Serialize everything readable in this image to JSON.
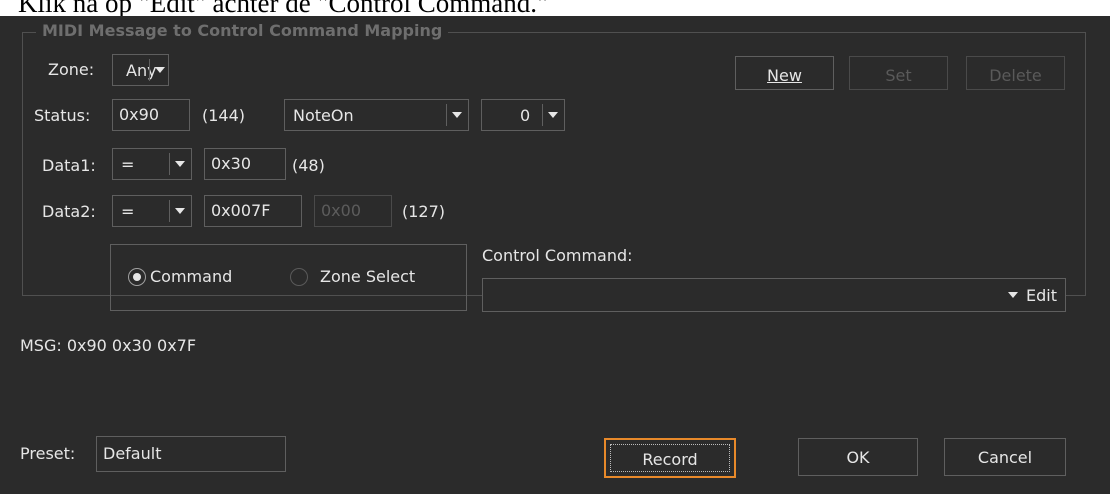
{
  "caption": "Klik na op \"Edit\" achter de \"Control Command.\"",
  "group_title": "MIDI Message to Control Command Mapping",
  "zone": {
    "label": "Zone:",
    "value": "Any"
  },
  "status": {
    "label": "Status:",
    "hex": "0x90",
    "dec": "(144)",
    "type": "NoteOn",
    "channel": "0"
  },
  "data1": {
    "label": "Data1:",
    "op": "=",
    "hex": "0x30",
    "dec": "(48)"
  },
  "data2": {
    "label": "Data2:",
    "op": "=",
    "hex": "0x007F",
    "hex2": "0x00",
    "dec": "(127)"
  },
  "buttons": {
    "new": "New",
    "set": "Set",
    "delete": "Delete",
    "edit": "Edit"
  },
  "radios": {
    "command": "Command",
    "zone_select": "Zone Select"
  },
  "control_command": {
    "label": "Control Command:",
    "value": ""
  },
  "msg": "MSG: 0x90 0x30 0x7F",
  "preset": {
    "label": "Preset:",
    "value": "Default"
  },
  "footer": {
    "record": "Record",
    "ok": "OK",
    "cancel": "Cancel"
  },
  "colors": {
    "background": "#2b2b2b",
    "text": "#e6e6e6",
    "focus_border": "#e8892a",
    "border": "#5f5f5f"
  }
}
